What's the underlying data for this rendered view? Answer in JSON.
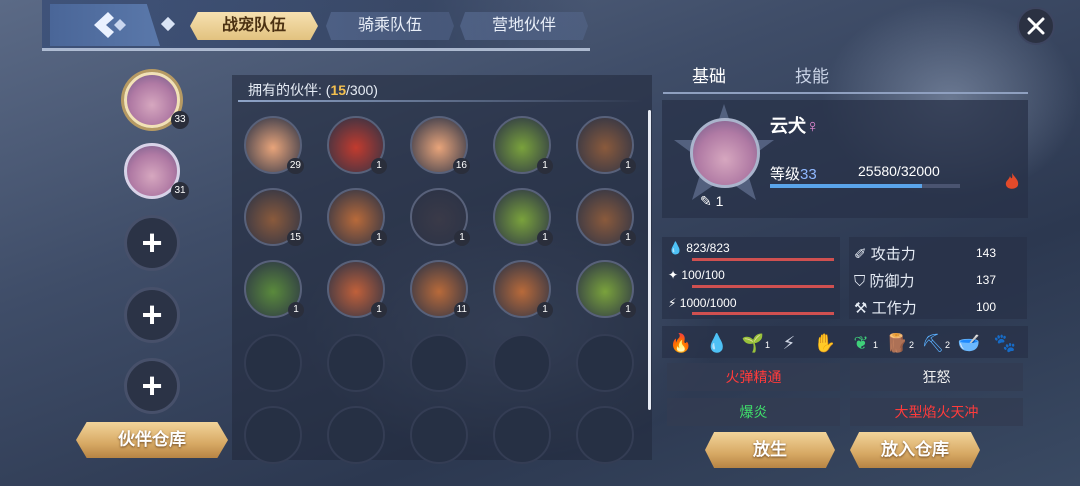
{
  "topbar": {
    "tabs": [
      {
        "label": "战宠队伍",
        "active": true
      },
      {
        "label": "骑乘队伍",
        "active": false
      },
      {
        "label": "营地伙伴",
        "active": false
      }
    ]
  },
  "team": {
    "slots": [
      {
        "type": "pet",
        "level": "33",
        "selected": true
      },
      {
        "type": "pet",
        "level": "31",
        "selected": false
      },
      {
        "type": "add",
        "icon": "plus-icon"
      },
      {
        "type": "add",
        "icon": "plus-icon"
      },
      {
        "type": "add",
        "icon": "plus-icon"
      }
    ],
    "warehouse_button": "伙伴仓库"
  },
  "owned": {
    "label": "拥有的伙伴:",
    "count": "15",
    "total": "/300",
    "pets": [
      {
        "level": "29",
        "color": "#e8a47a"
      },
      {
        "level": "1",
        "color": "#c23b2e"
      },
      {
        "level": "16",
        "color": "#e8a47a"
      },
      {
        "level": "1",
        "color": "#7aa23c"
      },
      {
        "level": "1",
        "color": "#8a5a3c"
      },
      {
        "level": "15",
        "color": "#8a5a3c"
      },
      {
        "level": "1",
        "color": "#b86a3a"
      },
      {
        "level": "1",
        "color": "#3a3a48"
      },
      {
        "level": "1",
        "color": "#7aa23c"
      },
      {
        "level": "1",
        "color": "#8a5a3c"
      },
      {
        "level": "1",
        "color": "#5a8a3c"
      },
      {
        "level": "1",
        "color": "#c0603a"
      },
      {
        "level": "11",
        "color": "#b86a3a"
      },
      {
        "level": "1",
        "color": "#b86a3a"
      },
      {
        "level": "1",
        "color": "#7aa23c"
      }
    ]
  },
  "detail": {
    "tabs": [
      {
        "label": "基础",
        "active": true
      },
      {
        "label": "技能",
        "active": false
      }
    ],
    "name": "云犬",
    "gender": "♀",
    "level_label": "等级",
    "level": "33",
    "exp": "25580/32000",
    "exp_fraction": 0.8,
    "command": "1",
    "hp": "823/823",
    "mp": "100/100",
    "stamina": "1000/1000",
    "attack_label": "攻击力",
    "attack": "143",
    "defense_label": "防御力",
    "defense": "137",
    "work_label": "工作力",
    "work": "100",
    "elements": [
      {
        "icon": "flame-work-icon",
        "level": ""
      },
      {
        "icon": "water-work-icon",
        "level": ""
      },
      {
        "icon": "plant-work-icon",
        "level": "1"
      },
      {
        "icon": "electric-work-icon",
        "level": ""
      },
      {
        "icon": "handiwork-icon",
        "level": ""
      },
      {
        "icon": "gather-work-icon",
        "level": "1"
      },
      {
        "icon": "lumber-work-icon",
        "level": "2"
      },
      {
        "icon": "mining-work-icon",
        "level": "2"
      },
      {
        "icon": "medicine-work-icon",
        "level": ""
      },
      {
        "icon": "transport-work-icon",
        "level": ""
      }
    ],
    "skills": [
      {
        "label": "火弹精通",
        "color": "red"
      },
      {
        "label": "狂怒",
        "color": "white"
      },
      {
        "label": "爆炎",
        "color": "green"
      },
      {
        "label": "大型焰火天冲",
        "color": "red"
      }
    ],
    "release_button": "放生",
    "store_button": "放入仓库"
  }
}
